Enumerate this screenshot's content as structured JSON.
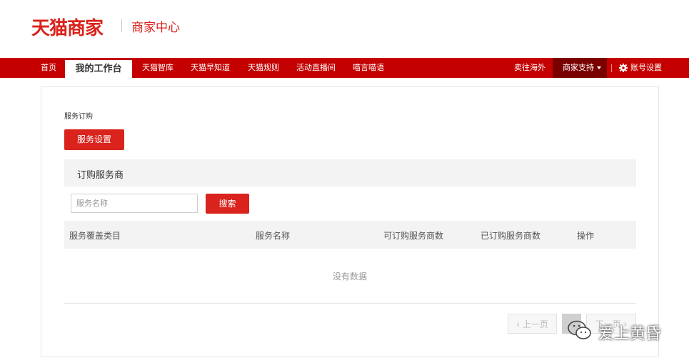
{
  "header": {
    "logo": "天猫商家",
    "subtitle": "商家中心"
  },
  "nav": {
    "items": [
      "首页",
      "我的工作台",
      "天猫智库",
      "天猫早知道",
      "天猫规则",
      "活动直播间",
      "喵言喵语"
    ],
    "active_index": 1,
    "right": {
      "overseas": "卖往海外",
      "support": "商家支持",
      "account": "账号设置"
    }
  },
  "page": {
    "breadcrumb": "服务订购",
    "settings_button": "服务设置",
    "section_title": "订购服务商",
    "search": {
      "placeholder": "服务名称",
      "button": "搜索"
    },
    "table": {
      "columns": [
        "服务覆盖类目",
        "服务名称",
        "可订购服务商数",
        "已订购服务商数",
        "操作"
      ],
      "empty_text": "没有数据"
    },
    "pager": {
      "prev": "上一页",
      "next": "下一页"
    }
  },
  "watermark": {
    "text": "爱上黄昏",
    "icon": "wechat-icon"
  },
  "colors": {
    "brand_red": "#d9231c",
    "nav_red": "#c40000",
    "nav_dark": "#7a0000"
  }
}
